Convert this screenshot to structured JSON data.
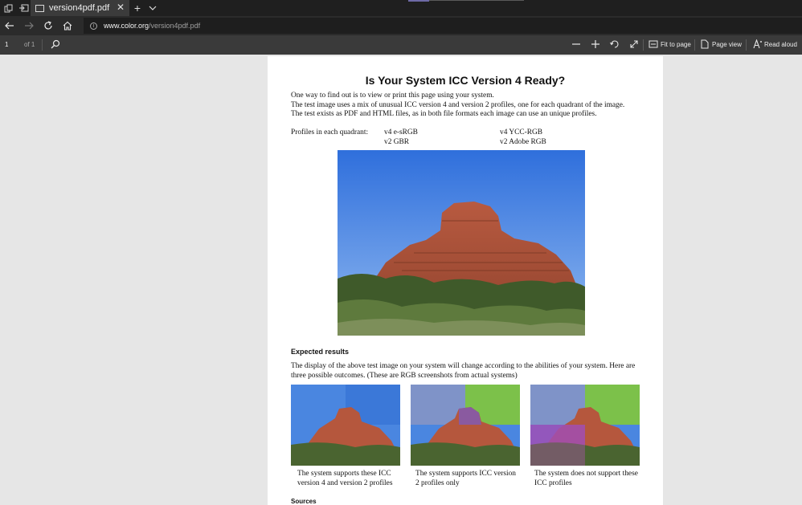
{
  "browser": {
    "tab_title": "version4pdf.pdf",
    "url_host": "www.color.org",
    "url_path": "/version4pdf.pdf"
  },
  "pdf_toolbar": {
    "page_number": "1",
    "page_of": "of 1",
    "fit_to_page": "Fit to page",
    "page_view": "Page view",
    "read_aloud": "Read aloud"
  },
  "document": {
    "title": "Is Your System ICC Version 4 Ready?",
    "intro_lines": [
      "One way to find out is to view or print this page using your system.",
      "The test image uses a mix of unusual ICC version 4 and version 2 profiles, one for each quadrant of the image.",
      "The test exists as PDF and HTML files, as in both file formats each image can use an unique profiles."
    ],
    "profiles_label": "Profiles in each quadrant:",
    "profiles": [
      "v4 e-sRGB",
      "v4 YCC-RGB",
      "v2 GBR",
      "v2 Adobe RGB"
    ],
    "expected_heading": "Expected results",
    "expected_text": "The display of the above test image on your system will change according to the abilities of your system. Here are three possible outcomes. (These are RGB screenshots from actual systems)",
    "captions": [
      "The system supports these ICC version 4 and version 2 profiles",
      "The system supports ICC version 2 profiles only",
      "The system does not support these ICC profiles"
    ],
    "sources_heading": "Sources"
  },
  "colors": {
    "sky": "#3d7fe0",
    "rock": "#b5553c",
    "tab_bg": "#3b3b3b"
  }
}
